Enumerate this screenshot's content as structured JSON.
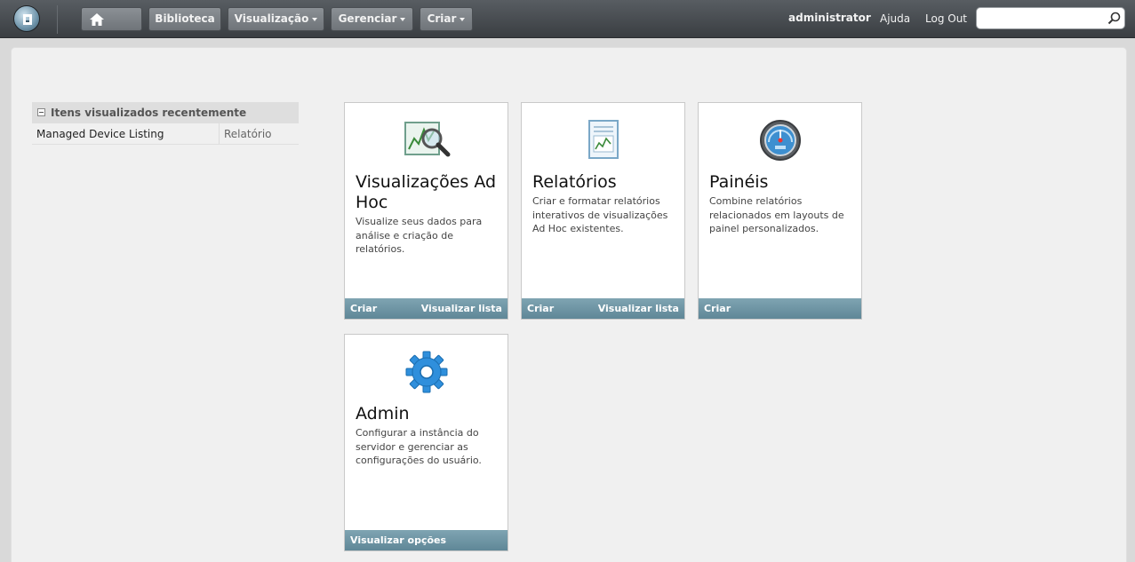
{
  "header": {
    "nav": {
      "library": "Biblioteca",
      "view": "Visualização",
      "manage": "Gerenciar",
      "create": "Criar"
    },
    "user": "administrator",
    "help": "Ajuda",
    "logout": "Log Out",
    "search_value": ""
  },
  "recent": {
    "title": "Itens visualizados recentemente",
    "items": [
      {
        "name": "Managed Device Listing",
        "type": "Relatório"
      }
    ]
  },
  "cards": [
    {
      "title": "Visualizações Ad Hoc",
      "description": "Visualize seus dados para análise e criação de relatórios.",
      "icon": "adhoc-chart-magnifier-icon",
      "primary": "Criar",
      "secondary": "Visualizar lista"
    },
    {
      "title": "Relatórios",
      "description": "Criar e formatar relatórios interativos de visualizações Ad Hoc existentes.",
      "icon": "report-document-icon",
      "primary": "Criar",
      "secondary": "Visualizar lista"
    },
    {
      "title": "Painéis",
      "description": "Combine relatórios relacionados em layouts de painel personalizados.",
      "icon": "dashboard-gauge-icon",
      "primary": "Criar",
      "secondary": ""
    },
    {
      "title": "Admin",
      "description": "Configurar a instância do servidor e gerenciar as configurações do usuário.",
      "icon": "gear-icon",
      "primary": "Visualizar opções",
      "secondary": ""
    }
  ]
}
